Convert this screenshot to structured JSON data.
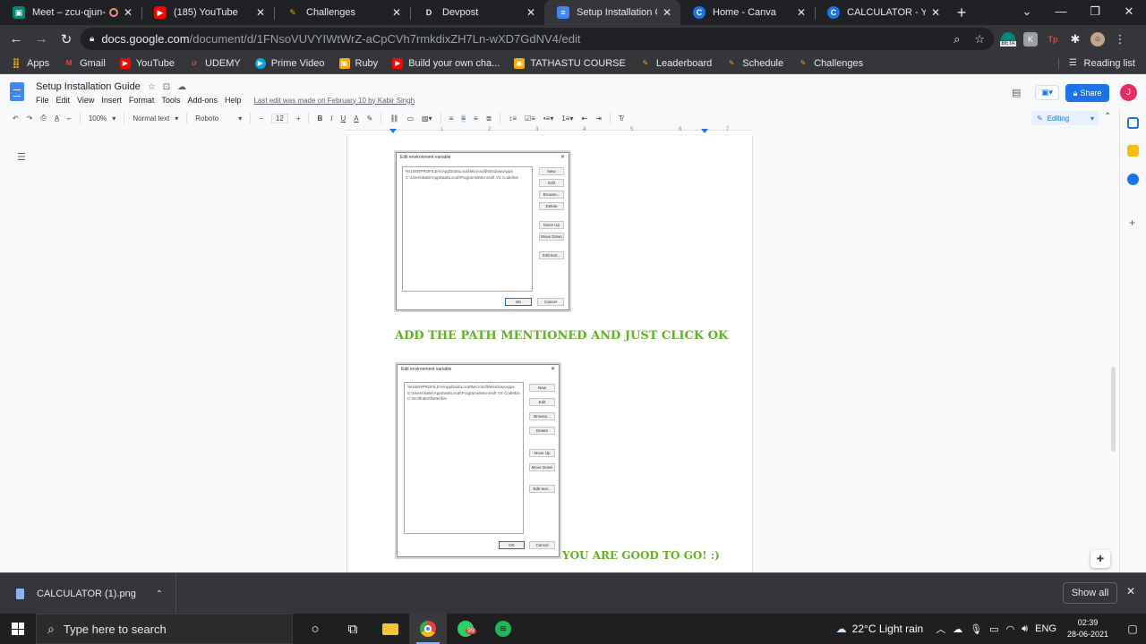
{
  "browser": {
    "tabs": [
      {
        "title": "Meet – zcu-qjun-",
        "color": "#00897b",
        "active": false
      },
      {
        "title": "(185) YouTube",
        "color": "#ff0000",
        "active": false
      },
      {
        "title": "Challenges",
        "color": "#f9ab00",
        "active": false
      },
      {
        "title": "Devpost",
        "color": "#003e54",
        "active": false
      },
      {
        "title": "Setup Installation Gui",
        "color": "#4285f4",
        "active": true
      },
      {
        "title": "Home - Canva",
        "color": "#00c4cc",
        "active": false
      },
      {
        "title": "CALCULATOR - YouTu",
        "color": "#1a73e8",
        "active": false
      }
    ],
    "new_tab": "+",
    "url_host": "docs.google.com",
    "url_path": "/document/d/1FNsoVUVYIWtWrZ-aCpCVh7rmkdixZH7Ln-wXD7GdNV4/edit",
    "beta_label": "BETA",
    "profile_letter": "J"
  },
  "bookmarks": [
    {
      "label": "Apps",
      "color": "#f9ab00"
    },
    {
      "label": "Gmail",
      "color": "#ea4335"
    },
    {
      "label": "YouTube",
      "color": "#ff0000"
    },
    {
      "label": "UDEMY",
      "color": "#a435f0"
    },
    {
      "label": "Prime Video",
      "color": "#00a8e1"
    },
    {
      "label": "Ruby",
      "color": "#cc342d"
    },
    {
      "label": "Build your own cha...",
      "color": "#ff0000"
    },
    {
      "label": "TATHASTU COURSE",
      "color": "#f9ab00"
    },
    {
      "label": "Leaderboard",
      "color": "#f9ab00"
    },
    {
      "label": "Schedule",
      "color": "#f9ab00"
    },
    {
      "label": "Challenges",
      "color": "#f9ab00"
    }
  ],
  "reading_list": "Reading list",
  "doc": {
    "title": "Setup Installation Guide",
    "menus": [
      "File",
      "Edit",
      "View",
      "Insert",
      "Format",
      "Tools",
      "Add-ons",
      "Help"
    ],
    "last_edit": "Last edit was made on February 10 by Kabir Singh",
    "share_label": "Share",
    "user_initial": "J"
  },
  "format_toolbar": {
    "zoom": "100%",
    "style": "Normal text",
    "font": "Roboto",
    "size": "12",
    "mode": "Editing"
  },
  "ruler_ticks": [
    "1",
    "2",
    "3",
    "4",
    "5",
    "6",
    "7"
  ],
  "content": {
    "dialog1": {
      "title": "Edit environment variable",
      "entries": [
        "%USERPROFILE%\\AppData\\Local\\Microsoft\\WindowsApps",
        "C:\\Users\\kabir\\AppData\\Local\\Programs\\Microsoft VS Code\\bin"
      ],
      "buttons": [
        "New",
        "Edit",
        "Browse...",
        "Delete",
        "Move Up",
        "Move Down",
        "Edit text..."
      ],
      "ok": "OK",
      "cancel": "Cancel"
    },
    "heading": "ADD THE PATH MENTIONED AND JUST CLICK OK",
    "dialog2": {
      "title": "Edit environment variable",
      "entries": [
        "%USERPROFILE%\\AppData\\Local\\Microsoft\\WindowsApps",
        "C:\\Users\\kabir\\AppData\\Local\\Programs\\Microsoft VS Code\\bin",
        "C:\\src\\flutter\\flutter\\bin"
      ],
      "buttons": [
        "New",
        "Edit",
        "Browse...",
        "Delete",
        "Move Up",
        "Move Down",
        "Edit text..."
      ],
      "ok": "OK",
      "cancel": "Cancel"
    },
    "closing": "YOU ARE GOOD TO GO! :)"
  },
  "download": {
    "filename": "CALCULATOR (1).png",
    "show_all": "Show all"
  },
  "taskbar": {
    "search_placeholder": "Type here to search",
    "whatsapp_badge": "99",
    "weather": "22°C  Light rain",
    "lang": "ENG",
    "time": "02:39",
    "date": "28-06-2021"
  }
}
